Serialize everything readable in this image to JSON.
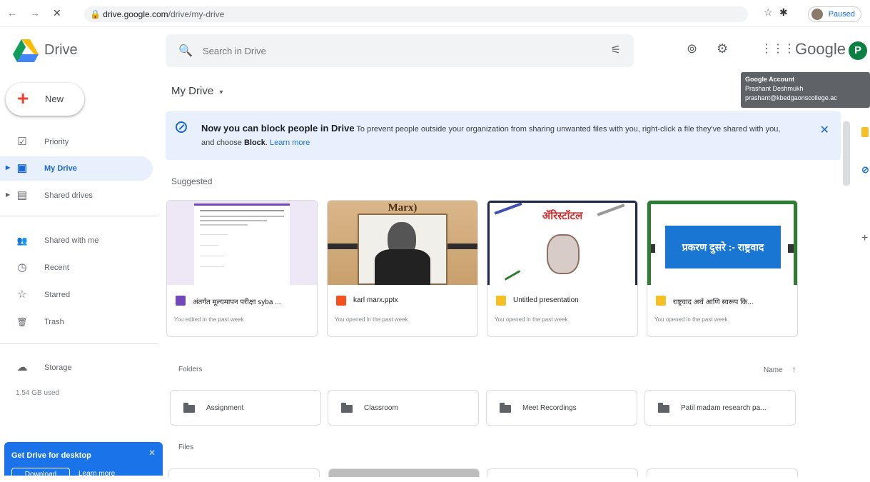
{
  "browser": {
    "back": "←",
    "forward": "→",
    "stop": "✕",
    "url_host": "drive.google.com",
    "url_path": "/drive/my-drive",
    "profile_status": "Paused"
  },
  "app": {
    "title": "Drive",
    "google_word": "Google",
    "profile_initial": "P"
  },
  "search": {
    "placeholder": "Search in Drive"
  },
  "tooltip": {
    "title": "Google Account",
    "name": "Prashant Deshmukh",
    "email": "prashant@kbedgaonscollege.ac"
  },
  "sidebar": {
    "new_label": "New",
    "items": [
      {
        "label": "Priority",
        "icon": "☑"
      },
      {
        "label": "My Drive",
        "icon": "▣"
      },
      {
        "label": "Shared drives",
        "icon": "▤"
      },
      {
        "label": "Shared with me",
        "icon": "👥"
      },
      {
        "label": "Recent",
        "icon": "◷"
      },
      {
        "label": "Starred",
        "icon": "☆"
      },
      {
        "label": "Trash",
        "icon": "🗑"
      },
      {
        "label": "Storage",
        "icon": "☁"
      }
    ],
    "storage_used": "1.54 GB used",
    "promo_title": "Get Drive for desktop",
    "promo_download": "Download",
    "promo_learn": "Learn more"
  },
  "main": {
    "title": "My Drive",
    "banner_strong": "Now you can block people in Drive",
    "banner_text1": " To prevent people outside your organization from sharing unwanted files with you, right-click a file they've shared with you, and choose ",
    "banner_block": "Block",
    "banner_text2": ". ",
    "banner_learn": "Learn more",
    "suggested_title": "Suggested",
    "folders_title": "Folders",
    "sort_label": "Name",
    "files_title": "Files"
  },
  "suggested": [
    {
      "name": "अंतर्गत मूल्यमापन परीक्षा syba ...",
      "meta": "You edited in the past week",
      "type": "form",
      "color": "#7248b9"
    },
    {
      "name": "karl marx.pptx",
      "meta": "You opened in the past week",
      "type": "pptx",
      "color": "#f4511e"
    },
    {
      "name": "Untitled presentation",
      "meta": "You opened in the past week",
      "type": "slides",
      "color": "#f6bf26"
    },
    {
      "name": "राष्ट्रवाद अर्थ आणि स्वरूप कि...",
      "meta": "You opened in the past week",
      "type": "slides",
      "color": "#f6bf26"
    }
  ],
  "thumbs": {
    "marx_title": "Marx)",
    "aristotle_title": "ॲरिस्टॉटल",
    "rashtravad_title": "प्रकरण दुसरे :- राष्ट्रवाद"
  },
  "folders": [
    {
      "name": "Assignment"
    },
    {
      "name": "Classroom"
    },
    {
      "name": "Meet Recordings"
    },
    {
      "name": "Patil madam research pa..."
    }
  ],
  "colors": {
    "accent": "#1a73e8",
    "active_nav_bg": "#e8f0fe",
    "banner_bg": "#e8f0fe",
    "profile_bg": "#0b8043"
  }
}
